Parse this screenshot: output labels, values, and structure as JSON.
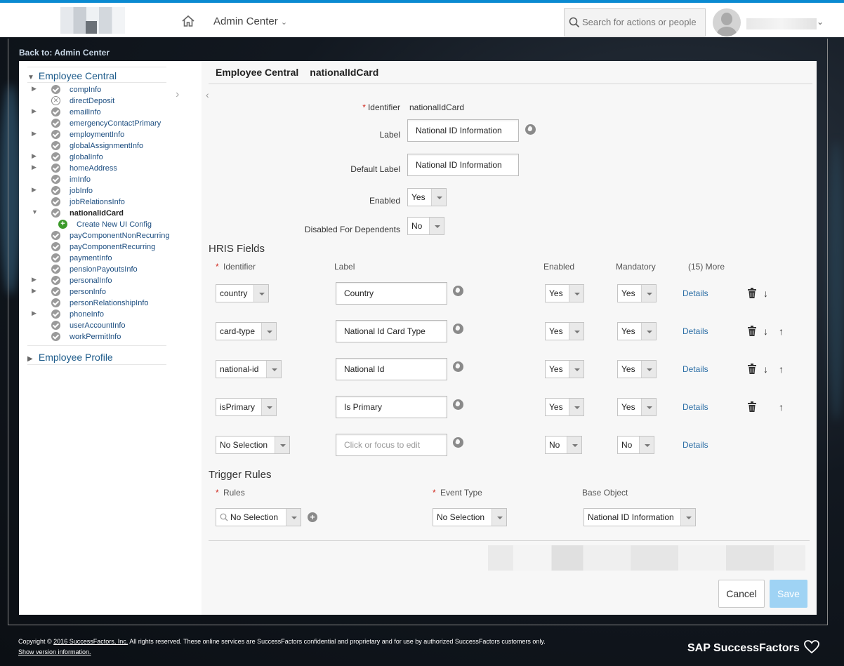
{
  "header": {
    "admin_center_label": "Admin Center",
    "search_placeholder": "Search for actions or people"
  },
  "back_link": "Back to: Admin Center",
  "sidebar": {
    "employee_central_label": "Employee Central",
    "employee_profile_label": "Employee Profile",
    "items": [
      {
        "label": "compInfo",
        "status": "check",
        "expandable": true
      },
      {
        "label": "directDeposit",
        "status": "error",
        "expandable": false
      },
      {
        "label": "emailInfo",
        "status": "check",
        "expandable": true
      },
      {
        "label": "emergencyContactPrimary",
        "status": "check",
        "expandable": false
      },
      {
        "label": "employmentInfo",
        "status": "check",
        "expandable": true
      },
      {
        "label": "globalAssignmentInfo",
        "status": "check",
        "expandable": false
      },
      {
        "label": "globalInfo",
        "status": "check",
        "expandable": true
      },
      {
        "label": "homeAddress",
        "status": "check",
        "expandable": true
      },
      {
        "label": "imInfo",
        "status": "check",
        "expandable": false
      },
      {
        "label": "jobInfo",
        "status": "check",
        "expandable": true
      },
      {
        "label": "jobRelationsInfo",
        "status": "check",
        "expandable": false
      },
      {
        "label": "nationalIdCard",
        "status": "check",
        "expandable": true,
        "selected": true
      },
      {
        "label": "payComponentNonRecurring",
        "status": "check",
        "expandable": false
      },
      {
        "label": "payComponentRecurring",
        "status": "check",
        "expandable": false
      },
      {
        "label": "paymentInfo",
        "status": "check",
        "expandable": false
      },
      {
        "label": "pensionPayoutsInfo",
        "status": "check",
        "expandable": false
      },
      {
        "label": "personalInfo",
        "status": "check",
        "expandable": true
      },
      {
        "label": "personInfo",
        "status": "check",
        "expandable": true
      },
      {
        "label": "personRelationshipInfo",
        "status": "check",
        "expandable": false
      },
      {
        "label": "phoneInfo",
        "status": "check",
        "expandable": true
      },
      {
        "label": "userAccountInfo",
        "status": "check",
        "expandable": false
      },
      {
        "label": "workPermitInfo",
        "status": "check",
        "expandable": false
      }
    ],
    "create_config_label": "Create New UI Config"
  },
  "main": {
    "breadcrumb": [
      "Employee Central",
      "nationalIdCard"
    ],
    "form": {
      "identifier_label": "Identifier",
      "identifier_value": "nationalIdCard",
      "label_label": "Label",
      "label_value": "National ID Information",
      "default_label_label": "Default Label",
      "default_label_value": "National ID Information",
      "enabled_label": "Enabled",
      "enabled_value": "Yes",
      "disabled_dependents_label": "Disabled For Dependents",
      "disabled_dependents_value": "No"
    },
    "hris": {
      "title": "HRIS Fields",
      "columns": {
        "identifier": "Identifier",
        "label": "Label",
        "enabled": "Enabled",
        "mandatory": "Mandatory",
        "more": "(15) More"
      },
      "rows": [
        {
          "identifier": "country",
          "label": "Country",
          "enabled": "Yes",
          "mandatory": "Yes",
          "details": "Details"
        },
        {
          "identifier": "card-type",
          "label": "National Id Card Type",
          "enabled": "Yes",
          "mandatory": "Yes",
          "details": "Details"
        },
        {
          "identifier": "national-id",
          "label": "National Id",
          "enabled": "Yes",
          "mandatory": "Yes",
          "details": "Details"
        },
        {
          "identifier": "isPrimary",
          "label": "Is Primary",
          "enabled": "Yes",
          "mandatory": "Yes",
          "details": "Details"
        },
        {
          "identifier": "No Selection",
          "label": "",
          "label_placeholder": "Click or focus to edit",
          "enabled": "No",
          "mandatory": "No",
          "details": "Details"
        }
      ]
    },
    "trigger": {
      "title": "Trigger Rules",
      "rules_label": "Rules",
      "event_type_label": "Event Type",
      "base_object_label": "Base Object",
      "rules_value": "No Selection",
      "event_type_value": "No Selection",
      "base_object_value": "National ID Information"
    },
    "buttons": {
      "cancel": "Cancel",
      "save": "Save"
    }
  },
  "footer": {
    "copyright_prefix": "Copyright ©",
    "copyright_link": "2016 SuccessFactors, Inc.",
    "copyright_text": "All rights reserved. These online services are SuccessFactors confidential and proprietary and for use by authorized SuccessFactors customers only.",
    "show_version": "Show version information.",
    "brand": "SAP SuccessFactors"
  },
  "colors": {
    "accent": "#0a8ad1",
    "link": "#2d6fa6",
    "required": "#d0271d",
    "save_disabled": "#9fd3f4"
  }
}
